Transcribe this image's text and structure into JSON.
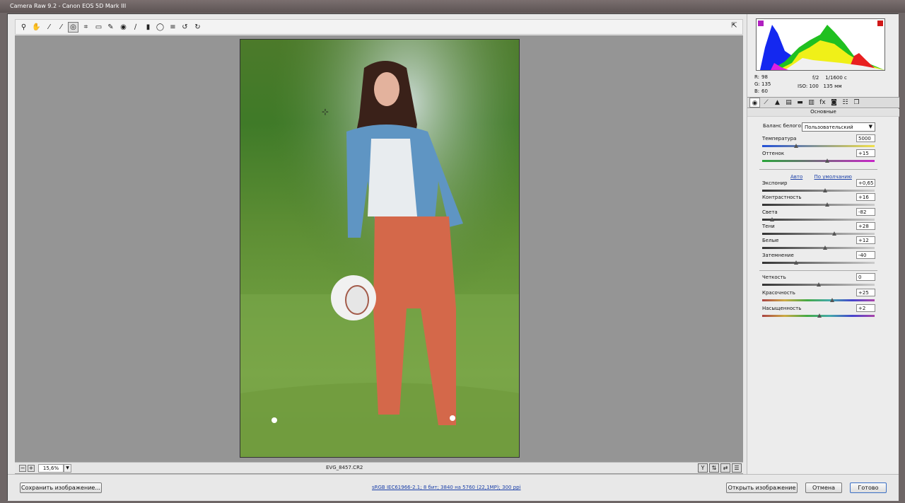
{
  "window": {
    "title": "Camera Raw 9.2  -  Canon EOS 5D Mark III"
  },
  "toolbar": {
    "tools": [
      {
        "name": "zoom-tool-icon",
        "glyph": "⚲"
      },
      {
        "name": "hand-tool-icon",
        "glyph": "✋"
      },
      {
        "name": "white-balance-tool-icon",
        "glyph": "⁄"
      },
      {
        "name": "color-sampler-tool-icon",
        "glyph": "⁄"
      },
      {
        "name": "targeted-adjustment-tool-icon",
        "glyph": "◎"
      },
      {
        "name": "crop-tool-icon",
        "glyph": "⌗"
      },
      {
        "name": "straighten-tool-icon",
        "glyph": "▭"
      },
      {
        "name": "spot-removal-tool-icon",
        "glyph": "✎"
      },
      {
        "name": "red-eye-removal-tool-icon",
        "glyph": "◉"
      },
      {
        "name": "adjustment-brush-icon",
        "glyph": "∕"
      },
      {
        "name": "graduated-filter-icon",
        "glyph": "▮"
      },
      {
        "name": "radial-filter-icon",
        "glyph": "◯"
      },
      {
        "name": "preferences-icon",
        "glyph": "≡"
      },
      {
        "name": "rotate-left-icon",
        "glyph": "↺"
      },
      {
        "name": "rotate-right-icon",
        "glyph": "↻"
      }
    ],
    "fullscreen_glyph": "⇱"
  },
  "status": {
    "zoom_value": "15,6%",
    "filename": "EVG_8457.CR2"
  },
  "histogram": {
    "r_label": "R:",
    "r_value": "98",
    "g_label": "G:",
    "g_value": "135",
    "b_label": "B:",
    "b_value": "60",
    "aperture": "f/2",
    "shutter": "1/1600 с",
    "iso": "ISO: 100",
    "focal": "135 мм"
  },
  "panel": {
    "section_title": "Основные",
    "wb_label": "Баланс белого:",
    "wb_value": "Пользовательский",
    "auto_label": "Авто",
    "default_label": "По умолчанию",
    "sliders": [
      {
        "label": "Температура",
        "value": "5000",
        "pos": 0.3,
        "track": "temp"
      },
      {
        "label": "Оттенок",
        "value": "+15",
        "pos": 0.58,
        "track": "tint"
      },
      {
        "label": "Экспонир",
        "value": "+0,65",
        "pos": 0.56,
        "track": "gray"
      },
      {
        "label": "Контрастность",
        "value": "+16",
        "pos": 0.58,
        "track": "gray"
      },
      {
        "label": "Света",
        "value": "-82",
        "pos": 0.09,
        "track": "gray"
      },
      {
        "label": "Тени",
        "value": "+28",
        "pos": 0.64,
        "track": "gray"
      },
      {
        "label": "Белые",
        "value": "+12",
        "pos": 0.56,
        "track": "gray"
      },
      {
        "label": "Затемнение",
        "value": "-40",
        "pos": 0.3,
        "track": "gray"
      },
      {
        "label": "Четкость",
        "value": "0",
        "pos": 0.5,
        "track": "gray"
      },
      {
        "label": "Красочность",
        "value": "+25",
        "pos": 0.62,
        "track": "color"
      },
      {
        "label": "Насыщенность",
        "value": "+2",
        "pos": 0.51,
        "track": "color"
      }
    ]
  },
  "bottom": {
    "save_label": "Сохранить изображение...",
    "info_link": "sRGB IEC61966-2.1; 8 бит; 3840 на 5760 (22,1МР); 300 ppi",
    "open_label": "Открыть изображение",
    "cancel_label": "Отмена",
    "done_label": "Готово"
  }
}
